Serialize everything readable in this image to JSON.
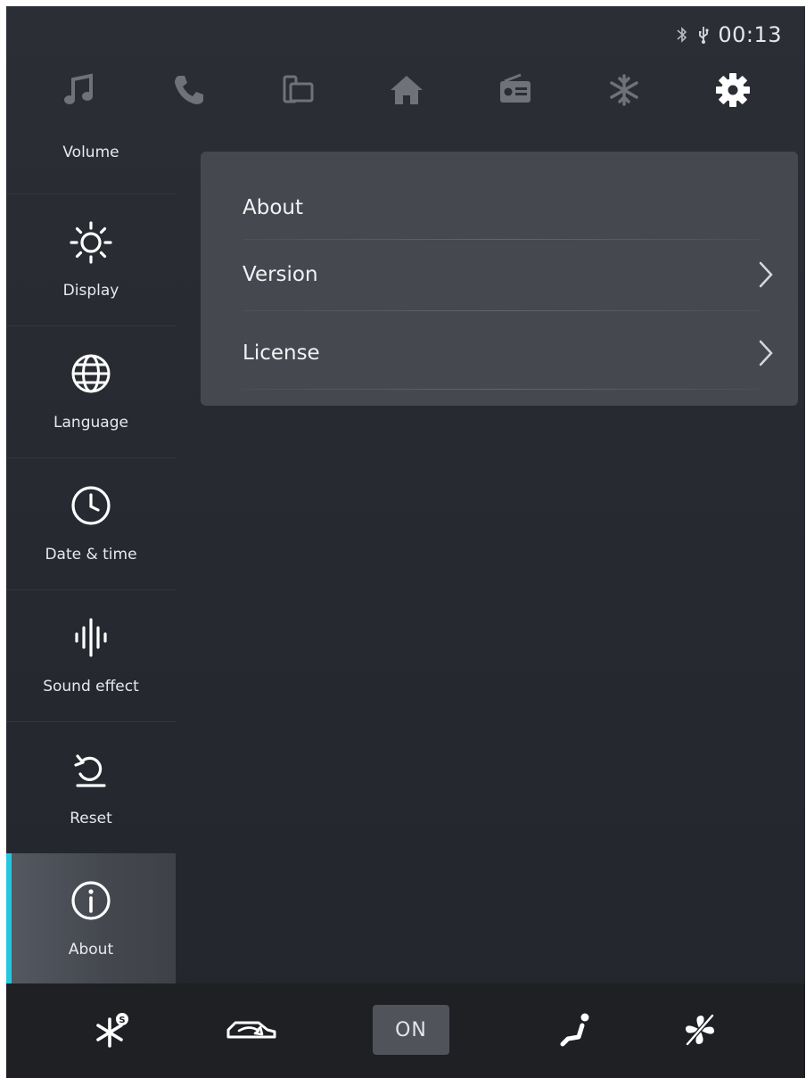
{
  "status": {
    "time": "00:13",
    "icons": [
      "bluetooth-icon",
      "usb-icon"
    ]
  },
  "topnav": {
    "items": [
      {
        "name": "music",
        "icon": "music-note-icon",
        "active": false
      },
      {
        "name": "phone",
        "icon": "phone-icon",
        "active": false
      },
      {
        "name": "screen-mirror",
        "icon": "screen-mirror-icon",
        "active": false
      },
      {
        "name": "home",
        "icon": "home-icon",
        "active": false
      },
      {
        "name": "radio",
        "icon": "radio-icon",
        "active": false
      },
      {
        "name": "climate",
        "icon": "snowflake-icon",
        "active": false
      },
      {
        "name": "settings",
        "icon": "gear-icon",
        "active": true
      }
    ]
  },
  "sidebar": {
    "items": [
      {
        "label": "Volume",
        "icon": "volume-icon",
        "active": false
      },
      {
        "label": "Display",
        "icon": "sun-icon",
        "active": false
      },
      {
        "label": "Language",
        "icon": "globe-icon",
        "active": false
      },
      {
        "label": "Date & time",
        "icon": "clock-icon",
        "active": false
      },
      {
        "label": "Sound effect",
        "icon": "sound-wave-icon",
        "active": false
      },
      {
        "label": "Reset",
        "icon": "reset-icon",
        "active": false
      },
      {
        "label": "About",
        "icon": "info-icon",
        "active": true
      }
    ]
  },
  "content": {
    "title": "About",
    "rows": [
      {
        "label": "Version"
      },
      {
        "label": "License"
      }
    ]
  },
  "bottombar": {
    "on_label": "ON",
    "icons": [
      "ac-snowflake-icon",
      "car-recirculation-icon",
      "seat-heat-icon",
      "fan-off-icon"
    ]
  },
  "colors": {
    "accent": "#25c7df",
    "background": "#262930",
    "card": "#46484f",
    "bottombar": "#1e2024"
  }
}
